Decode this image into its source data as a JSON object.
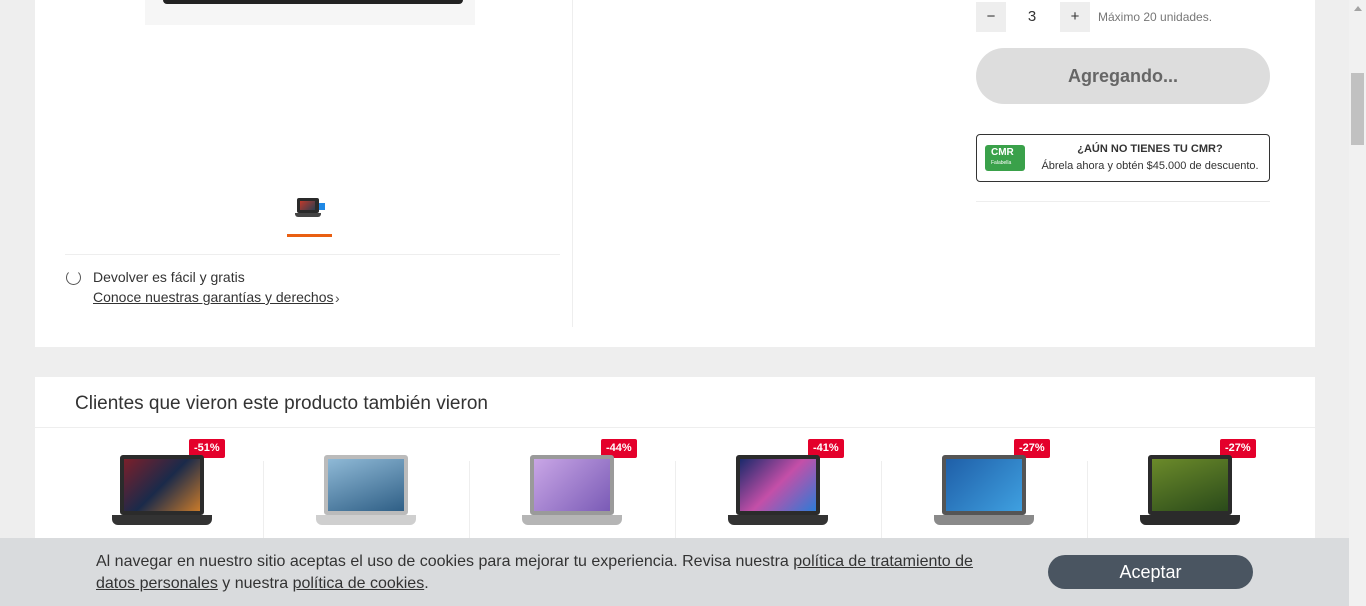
{
  "gallery": {
    "return_title": "Devolver es fácil y gratis",
    "return_link": "Conoce nuestras garantías y derechos",
    "chevron": "›"
  },
  "buybox": {
    "qty_minus": "−",
    "qty_value": "3",
    "qty_plus": "+",
    "qty_max": "Máximo 20 unidades.",
    "add_button": "Agregando...",
    "cmr": {
      "logo": "CMR",
      "logo_sub": "Falabella",
      "title": "¿AÚN NO TIENES TU CMR?",
      "subtitle": "Ábrela ahora y obtén $45.000 de descuento."
    }
  },
  "recommendations": {
    "title": "Clientes que vieron este producto también vieron",
    "items": [
      {
        "badge": "-51%"
      },
      {
        "badge": ""
      },
      {
        "badge": "-44%"
      },
      {
        "badge": "-41%"
      },
      {
        "badge": "-27%"
      },
      {
        "badge": "-27%"
      }
    ]
  },
  "cookie_banner": {
    "text_before": "Al navegar en nuestro sitio aceptas el uso de cookies para mejorar tu experiencia. Revisa nuestra ",
    "link_privacy": "política de tratamiento de datos personales",
    "text_middle": " y nuestra ",
    "link_cookies": "política de cookies",
    "text_after": ".",
    "accept_button": "Aceptar"
  },
  "colors": {
    "accent": "#e95f12",
    "discount": "#e4002b",
    "cmr_green": "#3aa14a",
    "accept_button": "#4a5561"
  }
}
